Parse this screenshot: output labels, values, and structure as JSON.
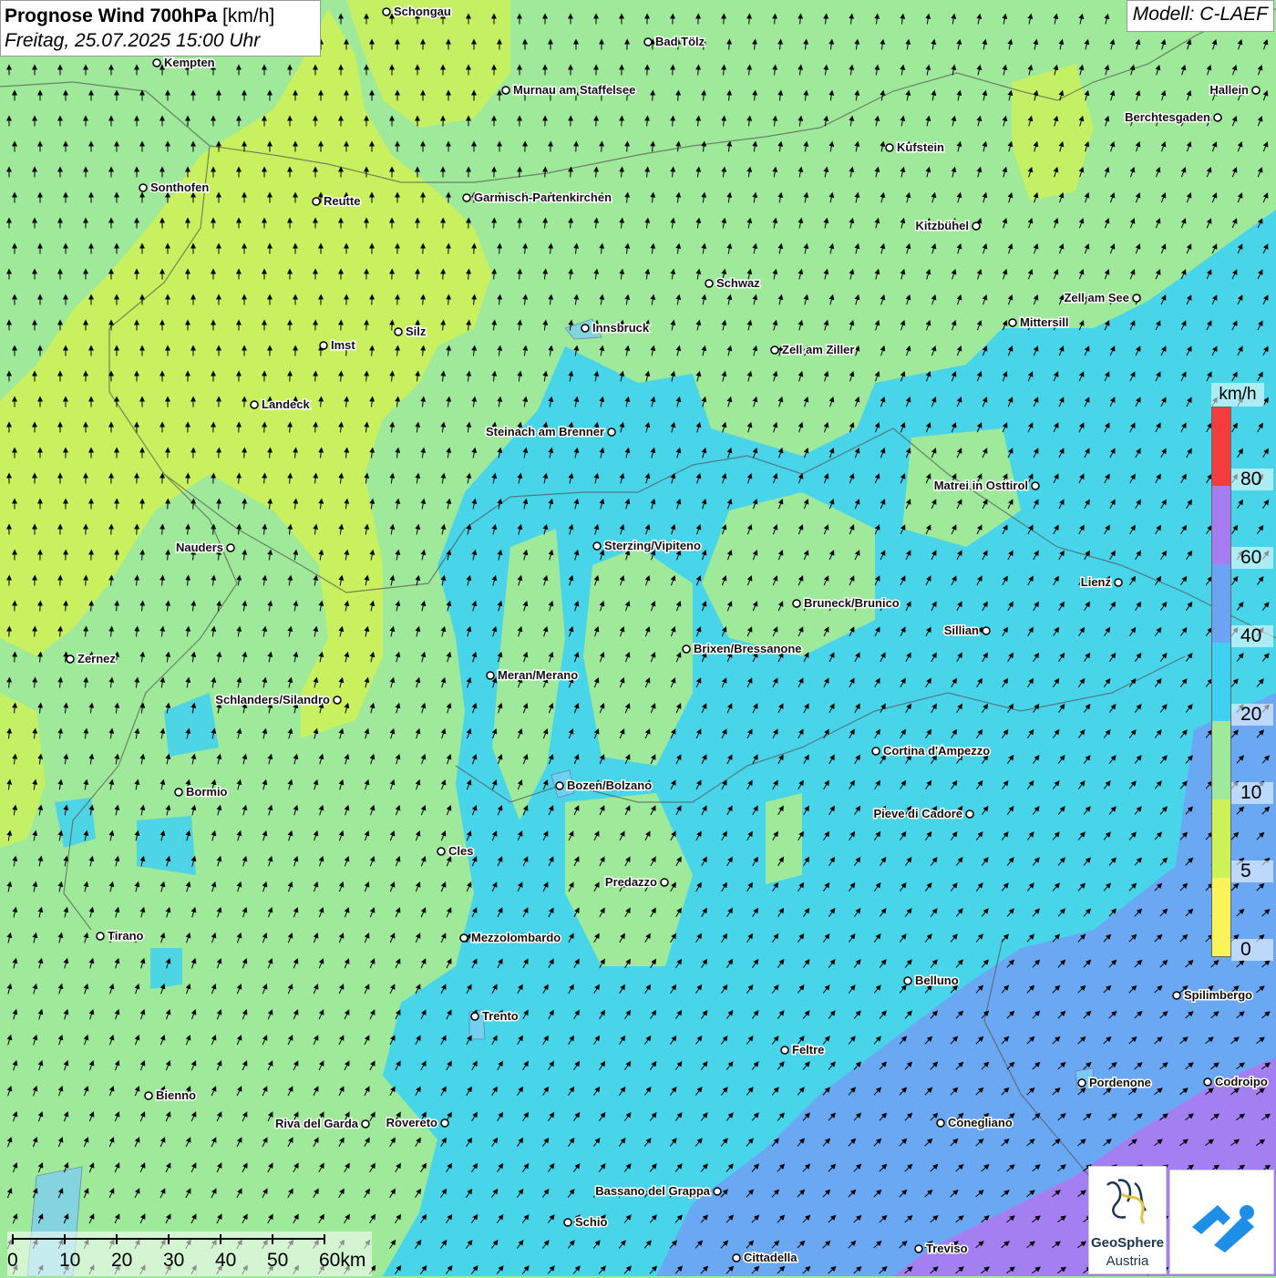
{
  "title": {
    "bold": "Prognose Wind 700hPa",
    "unit": " [km/h]",
    "date": "Freitag, 25.07.2025 15:00 Uhr"
  },
  "model": "Modell: C-LAEF",
  "legend": {
    "unit": "km/h",
    "colors": [
      "#fbf35a",
      "#cdf159",
      "#9ee99a",
      "#3ed1f2",
      "#6ea3f4",
      "#a77cf0",
      "#f33c3c"
    ],
    "labels": [
      "0",
      "5",
      "10",
      "20",
      "40",
      "60",
      "80"
    ]
  },
  "scalebar": {
    "labels": [
      "0",
      "10",
      "20",
      "30",
      "40",
      "50",
      "60km"
    ]
  },
  "logos": {
    "geosphere_name": "GeoSphere",
    "geosphere_sub": "Austria"
  },
  "cities": [
    {
      "name": "Schongau"
    },
    {
      "name": "Bad Tölz"
    },
    {
      "name": "Kempten"
    },
    {
      "name": "Murnau am Staffelsee"
    },
    {
      "name": "Hallein"
    },
    {
      "name": "Berchtesgaden"
    },
    {
      "name": "Kufstein"
    },
    {
      "name": "Sonthofen"
    },
    {
      "name": "Reutte"
    },
    {
      "name": "Garmisch-Partenkirchen"
    },
    {
      "name": "Kitzbühel"
    },
    {
      "name": "Schwaz"
    },
    {
      "name": "Zell am See"
    },
    {
      "name": "Mittersill"
    },
    {
      "name": "Innsbruck"
    },
    {
      "name": "Silz"
    },
    {
      "name": "Imst"
    },
    {
      "name": "Zell am Ziller"
    },
    {
      "name": "Landeck"
    },
    {
      "name": "Steinach am Brenner"
    },
    {
      "name": "Matrei in Osttirol"
    },
    {
      "name": "Nauders"
    },
    {
      "name": "Sterzing/Vipiteno"
    },
    {
      "name": "Lienz"
    },
    {
      "name": "Bruneck/Brunico"
    },
    {
      "name": "Sillian"
    },
    {
      "name": "Brixen/Bressanone"
    },
    {
      "name": "Zernez"
    },
    {
      "name": "Meran/Merano"
    },
    {
      "name": "Schlanders/Silandro"
    },
    {
      "name": "Cortina d'Ampezzo"
    },
    {
      "name": "Bozen/Bolzano"
    },
    {
      "name": "Bormio"
    },
    {
      "name": "Pieve di Cadore"
    },
    {
      "name": "Cles"
    },
    {
      "name": "Predazzo"
    },
    {
      "name": "Tirano"
    },
    {
      "name": "Mezzolombardo"
    },
    {
      "name": "Belluno"
    },
    {
      "name": "Spilimbergo"
    },
    {
      "name": "Trento"
    },
    {
      "name": "Feltre"
    },
    {
      "name": "Pordenone"
    },
    {
      "name": "Codroipo"
    },
    {
      "name": "Bienno"
    },
    {
      "name": "Riva del Garda"
    },
    {
      "name": "Rovereto"
    },
    {
      "name": "Conegliano"
    },
    {
      "name": "Bassano del Grappa"
    },
    {
      "name": "Schio"
    },
    {
      "name": "Treviso"
    },
    {
      "name": "Cittadella"
    }
  ]
}
